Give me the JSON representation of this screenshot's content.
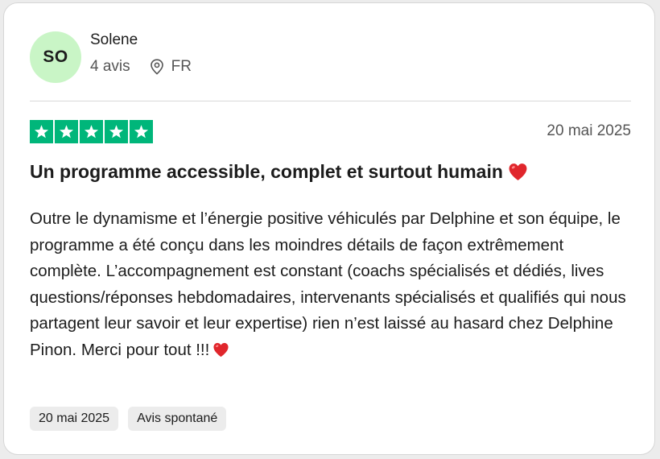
{
  "reviewer": {
    "initials": "SO",
    "name": "Solene",
    "review_count": "4 avis",
    "location_icon": "map-pin-icon",
    "country": "FR"
  },
  "rating": {
    "stars": 5,
    "max": 5,
    "color": "#00b67a",
    "date": "20 mai 2025"
  },
  "review": {
    "title": "Un programme accessible, complet et surtout humain",
    "body": "Outre le dynamisme et l’énergie positive véhiculés par Delphine et son équipe, le programme a été conçu dans les moindres détails de façon extrêmement complète. L’accompagnement est constant (coachs spécialisés et dédiés, lives questions/réponses hebdomadaires, intervenants spécialisés et qualifiés qui nous partagent leur savoir et leur expertise) rien n’est laissé au hasard chez Delphine Pinon. Merci pour tout !!!"
  },
  "tags": {
    "date": "20 mai 2025",
    "type": "Avis spontané"
  },
  "colors": {
    "avatar_bg": "#c9f5c6",
    "heart": "#e0262c"
  }
}
